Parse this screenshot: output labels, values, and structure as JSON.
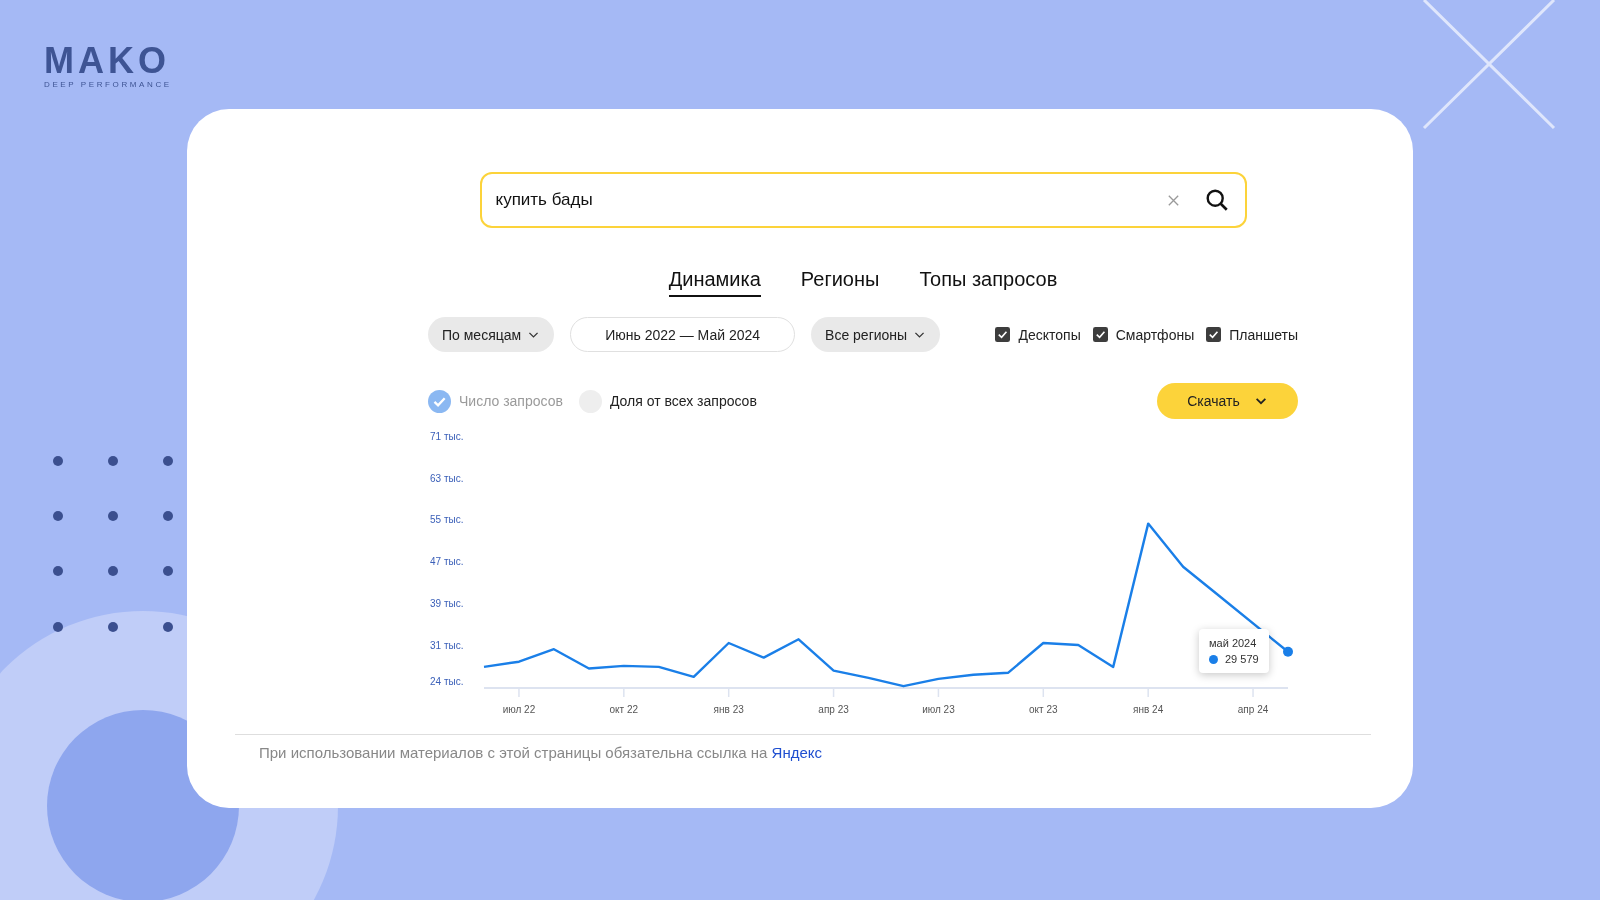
{
  "logo": {
    "name": "MAKO",
    "tagline": "DEEP PERFORMANCE"
  },
  "search": {
    "value": "купить бады"
  },
  "tabs": [
    {
      "label": "Динамика",
      "selected": true
    },
    {
      "label": "Регионы",
      "selected": false
    },
    {
      "label": "Топы запросов",
      "selected": false
    }
  ],
  "filters": {
    "period": "По месяцам",
    "range": "Июнь 2022 — Май 2024",
    "region": "Все регионы"
  },
  "devices": [
    {
      "label": "Десктопы",
      "checked": true
    },
    {
      "label": "Смартфоны",
      "checked": true
    },
    {
      "label": "Планшеты",
      "checked": true
    }
  ],
  "modes": [
    {
      "label": "Число запросов",
      "selected": true
    },
    {
      "label": "Доля от всех запросов",
      "selected": false
    }
  ],
  "download_button": "Скачать",
  "chart": {
    "chart_data": {
      "type": "line",
      "categories": [
        null,
        "июл 22",
        null,
        null,
        "окт 22",
        null,
        null,
        "янв 23",
        null,
        null,
        "апр 23",
        null,
        null,
        "июл 23",
        null,
        null,
        "окт 23",
        null,
        null,
        "янв 24",
        null,
        null,
        "апр 24",
        null
      ],
      "ylim": [
        22.66,
        71
      ],
      "yticks": [
        {
          "value": 24,
          "label": "24 тыс."
        },
        {
          "value": 31,
          "label": "31 тыс."
        },
        {
          "value": 39,
          "label": "39 тыс."
        },
        {
          "value": 47,
          "label": "47 тыс."
        },
        {
          "value": 55,
          "label": "55 тыс."
        },
        {
          "value": 63,
          "label": "63 тыс."
        },
        {
          "value": 71,
          "label": "71 тыс."
        }
      ],
      "series": [
        {
          "color": "#1a7fe8",
          "values": [
            26.7,
            27.7,
            30.1,
            26.4,
            26.9,
            26.7,
            24.8,
            31.3,
            28.5,
            32,
            26,
            24.6,
            23,
            24.4,
            25.2,
            25.6,
            31.3,
            30.9,
            26.7,
            54.2,
            45.9,
            40.5,
            null,
            29.6
          ]
        }
      ]
    },
    "tooltip": {
      "title": "май 2024",
      "value": "29 579"
    }
  },
  "footer": {
    "text": "При использовании материалов с этой страницы обязательна ссылка на",
    "link": "Яндекс"
  }
}
